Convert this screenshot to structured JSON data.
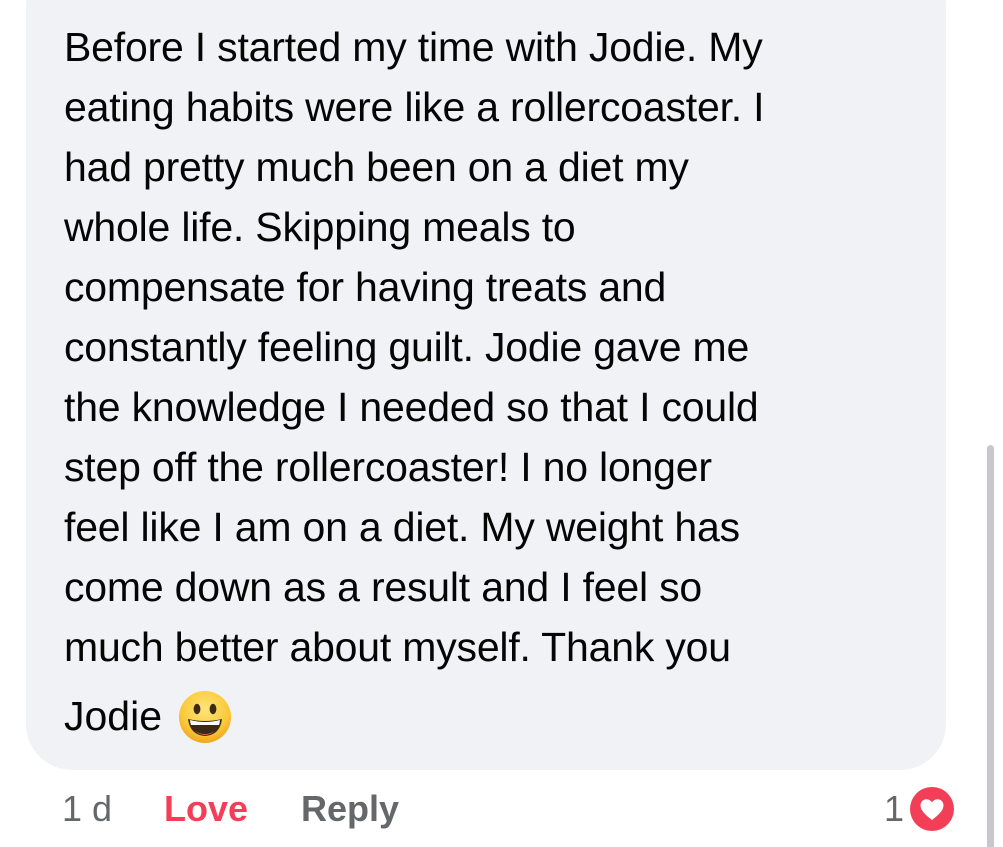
{
  "comment": {
    "clipped_top_line": "",
    "lines": [
      "Before I started my time with Jodie. My",
      "eating habits were like a rollercoaster. I",
      "had pretty much been on a diet my",
      "whole life. Skipping meals to",
      "compensate for having treats and",
      "constantly feeling guilt. Jodie gave me",
      "the knowledge I needed so that I could",
      "step off the rollercoaster!  I no longer",
      "feel like I am on a diet.  My weight has",
      "come down as a result and I feel so",
      "much better about myself. Thank you"
    ],
    "last_line": "Jodie",
    "emoji": "grinning-face-emoji"
  },
  "footer": {
    "time": "1 d",
    "reaction_label": "Love",
    "reply_label": "Reply"
  },
  "reactions": {
    "count": "1",
    "icon": "heart-icon",
    "badge_color": "#f33e58"
  },
  "colors": {
    "bubble": "#f0f2f5",
    "text": "#050505",
    "meta": "#65676b",
    "love": "#f33e58"
  }
}
